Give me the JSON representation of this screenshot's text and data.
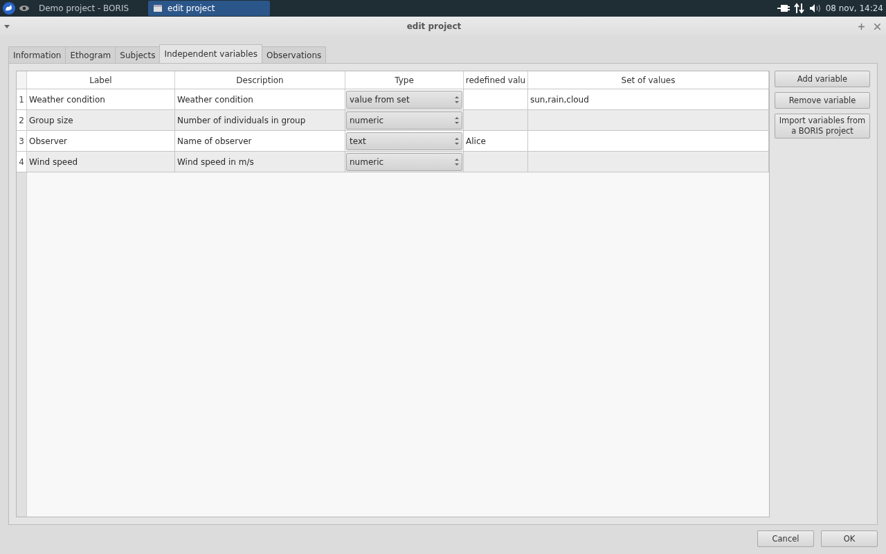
{
  "taskbar": {
    "tasks": [
      {
        "label": "Demo project - BORIS",
        "selected": false
      },
      {
        "label": "edit project",
        "selected": true
      }
    ],
    "clock": "08 nov, 14:24"
  },
  "window": {
    "title": "edit project"
  },
  "tabs": [
    {
      "label": "Information",
      "selected": false
    },
    {
      "label": "Ethogram",
      "selected": false
    },
    {
      "label": "Subjects",
      "selected": false
    },
    {
      "label": "Independent variables",
      "selected": true
    },
    {
      "label": "Observations",
      "selected": false
    }
  ],
  "table": {
    "columns": [
      "Label",
      "Description",
      "Type",
      "redefined valu",
      "Set of values"
    ],
    "rows": [
      {
        "number": "1",
        "label": "Weather condition",
        "description": "Weather condition",
        "type": "value from set",
        "predefined": "",
        "set": "sun,rain,cloud"
      },
      {
        "number": "2",
        "label": "Group size",
        "description": "Number of individuals in group",
        "type": "numeric",
        "predefined": "",
        "set": ""
      },
      {
        "number": "3",
        "label": "Observer",
        "description": "Name of observer",
        "type": "text",
        "predefined": "Alice",
        "set": ""
      },
      {
        "number": "4",
        "label": "Wind speed",
        "description": "Wind speed in m/s",
        "type": "numeric",
        "predefined": "",
        "set": ""
      }
    ]
  },
  "side_buttons": [
    "Add variable",
    "Remove variable",
    "Import variables from a BORIS project"
  ],
  "buttons": [
    "Cancel",
    "OK"
  ]
}
